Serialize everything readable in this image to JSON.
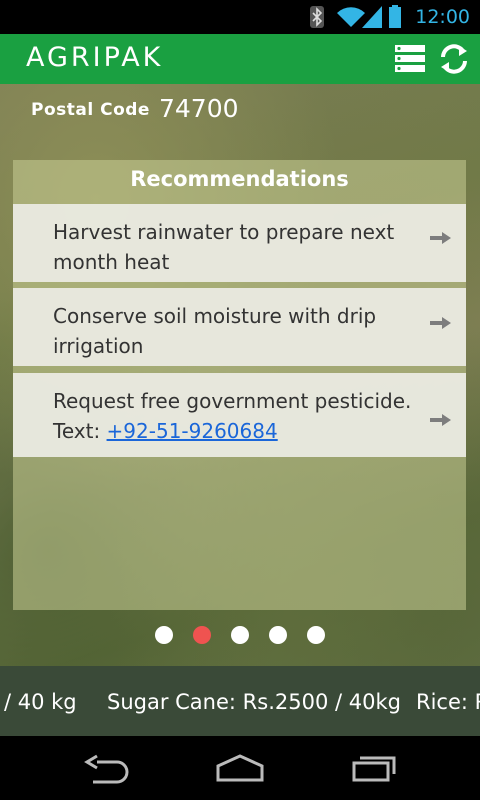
{
  "status_bar": {
    "time": "12:00"
  },
  "action_bar": {
    "title": "AGRIPAK",
    "list_icon": "list-icon",
    "refresh_icon": "refresh-icon"
  },
  "postal": {
    "label": "Postal Code",
    "value": "74700"
  },
  "recommendations": {
    "title": "Recommendations",
    "items": [
      {
        "text": "Harvest rainwater to prepare next month heat"
      },
      {
        "text": "Conserve soil moisture with drip irrigation"
      },
      {
        "text": "Request free government pesticide.",
        "contact_prefix": "Text:",
        "contact": "+92-51-9260684"
      }
    ]
  },
  "pager": {
    "count": 5,
    "active_index": 1
  },
  "ticker": {
    "items": [
      "/ 40 kg",
      "Sugar Cane: Rs.2500 / 40kg",
      "Rice: R"
    ]
  },
  "colors": {
    "action_bar": "#1aa041",
    "status_accent": "#33b5e5",
    "active_dot": "#ef5350",
    "ticker_bg": "#3a4a38",
    "link": "#1a66d9"
  }
}
